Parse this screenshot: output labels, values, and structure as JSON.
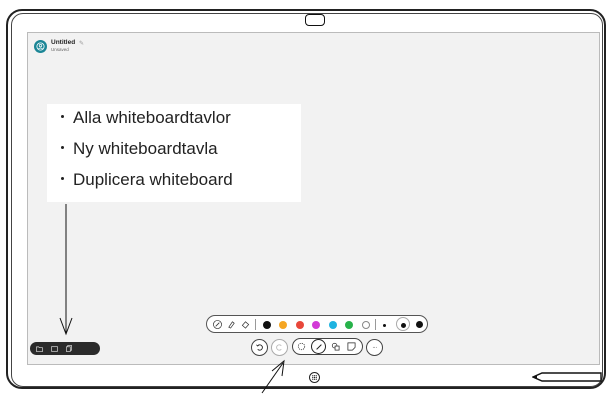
{
  "whiteboard": {
    "title": "Untitled",
    "subtitle": "Unsaved"
  },
  "menu": {
    "items": [
      {
        "label": "Alla whiteboardtavlor"
      },
      {
        "label": "Ny whiteboardtavla"
      },
      {
        "label": "Duplicera whiteboard"
      }
    ]
  },
  "palette": {
    "tools": [
      "pen-icon",
      "highlighter-icon",
      "eraser-icon"
    ],
    "colors": [
      "#111111",
      "#f5a623",
      "#e8473a",
      "#d23ad6",
      "#1fb3e0",
      "#27b24a",
      "#ffffff"
    ],
    "sizes": [
      "small",
      "medium",
      "large"
    ]
  },
  "toolbar": {
    "more_label": "···",
    "icons": [
      "undo-icon",
      "redo-icon",
      "lasso-icon",
      "pen-tool-icon",
      "shapes-icon",
      "sticky-note-icon",
      "more-icon"
    ]
  },
  "left_pill": {
    "icons": [
      "folder-icon",
      "new-whiteboard-icon",
      "duplicate-icon"
    ]
  }
}
